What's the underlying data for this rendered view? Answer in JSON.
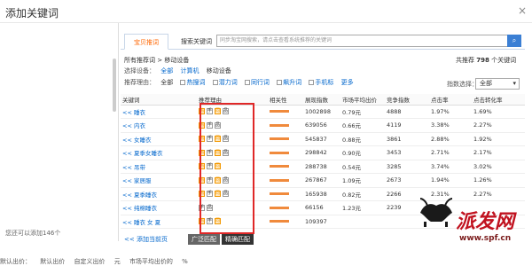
{
  "window": {
    "title": "添加关键词",
    "close": "×"
  },
  "left": {
    "count_text": "您还可以添加146个"
  },
  "tabs": [
    {
      "label": "宝贝推词"
    },
    {
      "label": "搜索关键词"
    }
  ],
  "search": {
    "placeholder": "同步淘宝网搜索，请点击查看系统推荐的关键词",
    "button_icon": "search-icon"
  },
  "filters": {
    "row1": {
      "label": "所有推荐词",
      "sep": ">",
      "value": "移动设备"
    },
    "row2": {
      "label": "选择设备：",
      "options": [
        "全部",
        "计算机",
        "移动设备"
      ]
    },
    "row3": {
      "label": "推荐理由：",
      "options": [
        "全部",
        "热搜词",
        "潜力词",
        "同行词",
        "飙升词",
        "手机标"
      ],
      "more": "更多"
    }
  },
  "recommend": {
    "prefix": "共推荐",
    "count": "798",
    "suffix": "个关键词"
  },
  "sort": {
    "label": "指数选择：",
    "value": "全部"
  },
  "table": {
    "headers": [
      "关键词",
      "推荐理由",
      "相关性",
      "展现指数",
      "市场平均出价",
      "竞争指数",
      "点击率",
      "点击转化率"
    ],
    "rows": [
      {
        "kw": "<< 睡衣",
        "reasons": [
          "热",
          "手",
          "同",
          "品"
        ],
        "rel": 1.0,
        "impr": "1002898",
        "bid": "0.79元",
        "comp": "4888",
        "ctr": "1.97%",
        "cvr": "1.69%"
      },
      {
        "kw": "<< 内衣",
        "reasons": [
          "热",
          "手",
          "品"
        ],
        "rel": 1.0,
        "impr": "639056",
        "bid": "0.66元",
        "comp": "4119",
        "ctr": "3.38%",
        "cvr": "2.27%"
      },
      {
        "kw": "<< 女睡衣",
        "reasons": [
          "热",
          "手",
          "同",
          "品"
        ],
        "rel": 1.0,
        "impr": "545837",
        "bid": "0.88元",
        "comp": "3861",
        "ctr": "2.88%",
        "cvr": "1.92%"
      },
      {
        "kw": "<< 夏季女睡衣",
        "reasons": [
          "热",
          "手",
          "同",
          "品"
        ],
        "rel": 1.0,
        "impr": "298842",
        "bid": "0.90元",
        "comp": "3453",
        "ctr": "2.71%",
        "cvr": "2.17%"
      },
      {
        "kw": "<< 吊带",
        "reasons": [
          "热",
          "手",
          "同"
        ],
        "rel": 1.0,
        "impr": "288738",
        "bid": "0.54元",
        "comp": "3285",
        "ctr": "3.74%",
        "cvr": "3.02%"
      },
      {
        "kw": "<< 家居服",
        "reasons": [
          "热",
          "手",
          "同",
          "品"
        ],
        "rel": 1.0,
        "impr": "267867",
        "bid": "1.09元",
        "comp": "2673",
        "ctr": "1.94%",
        "cvr": "1.26%"
      },
      {
        "kw": "<< 夏季睡衣",
        "reasons": [
          "热",
          "手",
          "同",
          "品"
        ],
        "rel": 1.0,
        "impr": "165938",
        "bid": "0.82元",
        "comp": "2266",
        "ctr": "2.31%",
        "cvr": "2.27%"
      },
      {
        "kw": "<< 纯棉睡衣",
        "reasons": [
          "手",
          "品"
        ],
        "rel": 1.0,
        "impr": "66156",
        "bid": "1.23元",
        "comp": "2239",
        "ctr": "",
        "cvr": ""
      },
      {
        "kw": "<< 睡衣 女 夏",
        "reasons": [
          "热",
          "手",
          "同"
        ],
        "rel": 1.0,
        "impr": "109397",
        "bid": "",
        "comp": "",
        "ctr": "",
        "cvr": ""
      }
    ]
  },
  "bottom": {
    "add_page": "<< 添加当前页",
    "btn_broad": "广泛匹配",
    "btn_exact": "精确匹配"
  },
  "footer": {
    "items": [
      "默认出价：",
      "默认出价",
      "自定义出价",
      "元",
      "市场平均出价的",
      "%"
    ]
  },
  "watermark": {
    "name": "派发网",
    "url": "www.spf.cn"
  },
  "colors": {
    "accent": "#f60",
    "link": "#0066cc",
    "highlight_box": "#e02828",
    "relevance_bar": "#f08a3c"
  }
}
